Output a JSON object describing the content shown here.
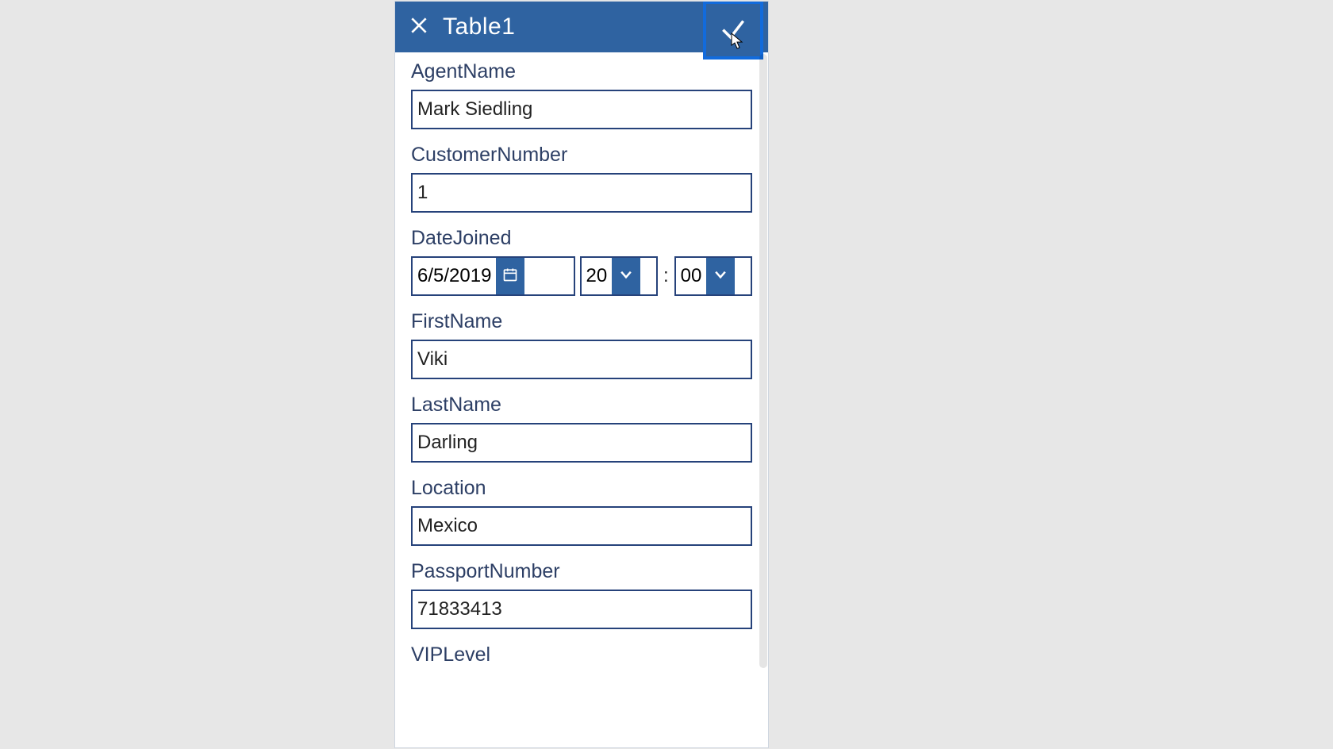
{
  "header": {
    "title": "Table1"
  },
  "fields": {
    "agentName": {
      "label": "AgentName",
      "value": "Mark Siedling"
    },
    "customerNumber": {
      "label": "CustomerNumber",
      "value": "1"
    },
    "dateJoined": {
      "label": "DateJoined",
      "date": "6/5/2019",
      "hour": "20",
      "minute": "00"
    },
    "firstName": {
      "label": "FirstName",
      "value": "Viki"
    },
    "lastName": {
      "label": "LastName",
      "value": "Darling"
    },
    "location": {
      "label": "Location",
      "value": "Mexico"
    },
    "passportNumber": {
      "label": "PassportNumber",
      "value": "71833413"
    },
    "vipLevel": {
      "label": "VIPLevel"
    }
  },
  "colors": {
    "primary": "#2f63a1",
    "border": "#26427a",
    "highlight": "#126bdc"
  }
}
